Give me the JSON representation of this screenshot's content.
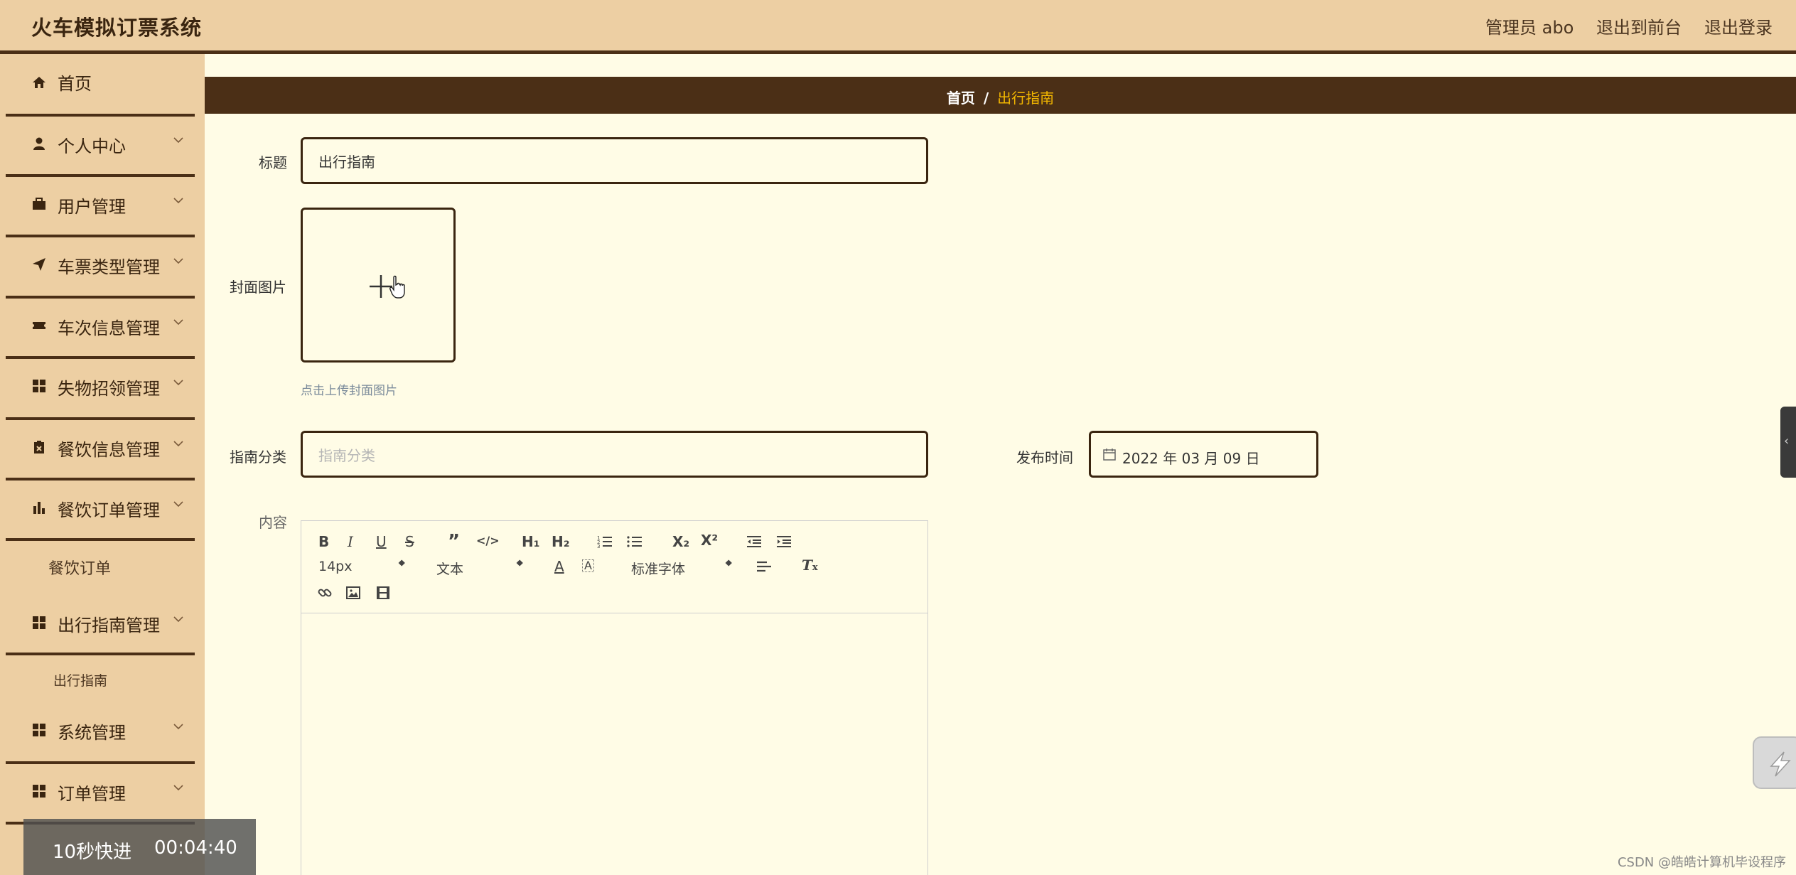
{
  "header": {
    "title": "火车模拟订票系统",
    "user_label": "管理员 abo",
    "to_front_label": "退出到前台",
    "logout_label": "退出登录"
  },
  "sidebar": {
    "items": [
      {
        "label": "首页",
        "icon": "home-icon"
      },
      {
        "label": "个人中心",
        "icon": "user-icon"
      },
      {
        "label": "用户管理",
        "icon": "briefcase-icon"
      },
      {
        "label": "车票类型管理",
        "icon": "send-icon"
      },
      {
        "label": "车次信息管理",
        "icon": "ticket-icon"
      },
      {
        "label": "失物招领管理",
        "icon": "grid-icon"
      },
      {
        "label": "餐饮信息管理",
        "icon": "clipboard-icon"
      },
      {
        "label": "餐饮订单管理",
        "icon": "bar-chart-icon"
      },
      {
        "label": "出行指南管理",
        "icon": "grid-icon"
      },
      {
        "label": "系统管理",
        "icon": "grid-icon"
      },
      {
        "label": "订单管理",
        "icon": "grid-icon"
      }
    ],
    "sub_meal_order": "餐饮订单",
    "sub_travel_guide": "出行指南"
  },
  "breadcrumb": {
    "home": "首页",
    "separator": "/",
    "current": "出行指南"
  },
  "form": {
    "title_label": "标题",
    "title_value": "出行指南",
    "cover_label": "封面图片",
    "cover_hint": "点击上传封面图片",
    "category_label": "指南分类",
    "category_placeholder": "指南分类",
    "publish_label": "发布时间",
    "publish_value": "2022 年 03 月 09 日",
    "content_label": "内容"
  },
  "editor": {
    "font_size": "14px",
    "paragraph": "文本",
    "font_family": "标准字体",
    "sub_label": "X₂",
    "sup_label": "X²",
    "h1": "H₁",
    "h2": "H₂"
  },
  "overlay": {
    "fast_forward": "10秒快进",
    "timestamp": "00:04:40"
  },
  "watermark": "CSDN @皓皓计算机毕设程序",
  "colors": {
    "header_bg": "#edcfa3",
    "accent_dark": "#4b2f16",
    "page_bg": "#fffce6",
    "breadcrumb_current": "#f2b600"
  }
}
